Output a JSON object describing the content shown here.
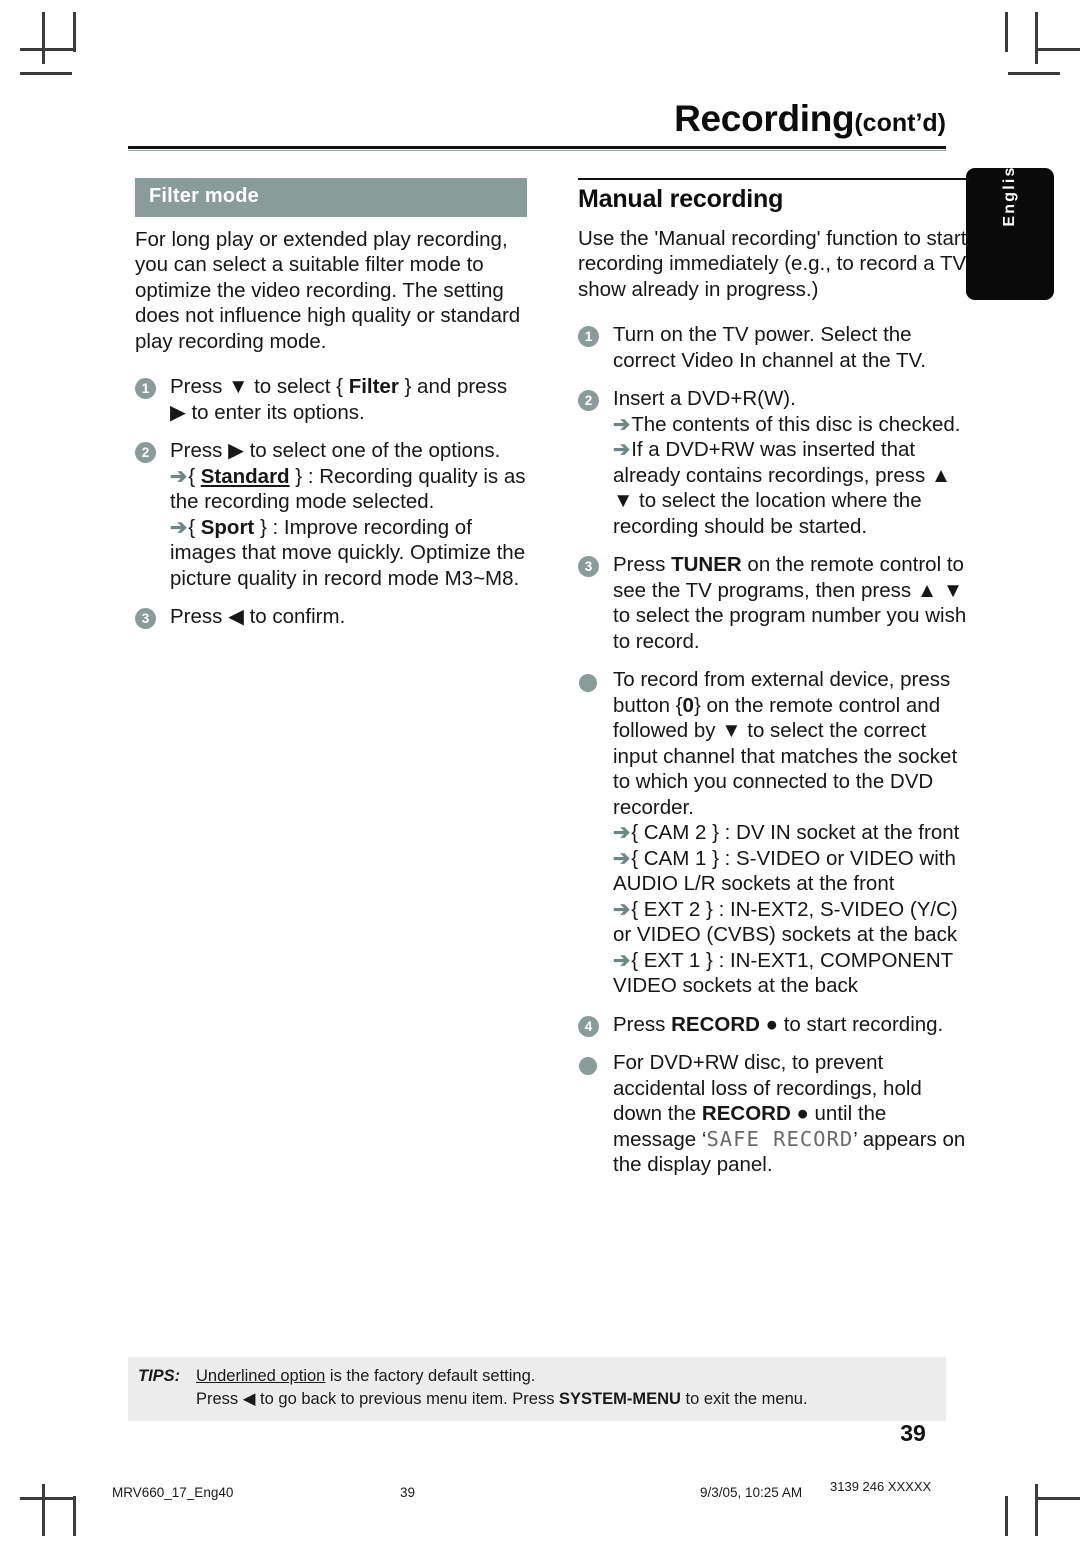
{
  "header": {
    "title": "Recording",
    "title_suffix": "(cont’d)"
  },
  "lang_tab": {
    "label": "English"
  },
  "left_column": {
    "heading": "Filter mode",
    "intro": "For long play or extended play recording, you can select a suitable filter mode to optimize the video recording. The setting does not influence high quality or standard play recording mode.",
    "steps": [
      {
        "num": "1",
        "parts": [
          {
            "t": "Press "
          },
          {
            "t": "▼",
            "style": "plain"
          },
          {
            "t": " to select { "
          },
          {
            "t": "Filter",
            "style": "bold"
          },
          {
            "t": " } and press "
          },
          {
            "t": "▶",
            "style": "plain"
          },
          {
            "t": " to enter its options."
          }
        ]
      },
      {
        "num": "2",
        "parts": [
          {
            "t": "Press "
          },
          {
            "t": "▶",
            "style": "plain"
          },
          {
            "t": " to select one of the options."
          }
        ],
        "arrows": [
          {
            "parts": [
              {
                "t": "{ "
              },
              {
                "t": "Standard",
                "style": "bold-underline"
              },
              {
                "t": " } :  Recording quality is as the recording mode selected."
              }
            ]
          },
          {
            "parts": [
              {
                "t": "{ "
              },
              {
                "t": "Sport",
                "style": "bold"
              },
              {
                "t": " } :  Improve recording of images that move quickly.  Optimize the picture quality in record mode M3~M8."
              }
            ]
          }
        ]
      },
      {
        "num": "3",
        "parts": [
          {
            "t": "Press "
          },
          {
            "t": "◀",
            "style": "plain"
          },
          {
            "t": "  to confirm."
          }
        ]
      }
    ]
  },
  "right_column": {
    "heading": "Manual recording",
    "intro": "Use the 'Manual recording' function to start recording immediately (e.g., to record a TV show already in progress.)",
    "steps": [
      {
        "num": "1",
        "parts": [
          {
            "t": "Turn on the TV power.  Select the correct Video In channel at the TV."
          }
        ]
      },
      {
        "num": "2",
        "parts": [
          {
            "t": "Insert a DVD+R(W)."
          }
        ],
        "arrows": [
          {
            "parts": [
              {
                "t": "The contents of this disc is checked."
              }
            ]
          },
          {
            "parts": [
              {
                "t": "If a DVD+RW was inserted that already contains recordings, press "
              },
              {
                "t": "▲ ▼",
                "style": "plain"
              },
              {
                "t": " to select the location where the recording should be started."
              }
            ]
          }
        ]
      },
      {
        "num": "3",
        "parts": [
          {
            "t": "Press "
          },
          {
            "t": "TUNER",
            "style": "bold"
          },
          {
            "t": " on the remote control to see the TV programs, then press "
          },
          {
            "t": "▲ ▼",
            "style": "plain"
          },
          {
            "t": "  to select the program number you wish to record."
          }
        ]
      }
    ],
    "bullet_external": {
      "parts": [
        {
          "t": "To record from external device, press button {"
        },
        {
          "t": "0",
          "style": "bold"
        },
        {
          "t": "} on the remote control and followed by "
        },
        {
          "t": "▼",
          "style": "plain"
        },
        {
          "t": " to select the correct input channel that matches the socket to which you connected to the DVD recorder."
        }
      ],
      "sockets": [
        {
          "parts": [
            {
              "t": "{ CAM 2 } :  DV IN socket at the front"
            }
          ]
        },
        {
          "parts": [
            {
              "t": "{ CAM 1 } : S-VIDEO or VIDEO with AUDIO L/R sockets at the front"
            }
          ]
        },
        {
          "parts": [
            {
              "t": "{ EXT 2 } :  IN-EXT2, S-VIDEO (Y/C) or VIDEO (CVBS) sockets at the back"
            }
          ]
        },
        {
          "parts": [
            {
              "t": "{ EXT 1 } :  IN-EXT1, COMPONENT VIDEO sockets at the back"
            }
          ]
        }
      ]
    },
    "step4": {
      "num": "4",
      "parts": [
        {
          "t": "Press "
        },
        {
          "t": "RECORD",
          "style": "bold"
        },
        {
          "t": " ●",
          "style": "plain"
        },
        {
          "t": " to start recording."
        }
      ]
    },
    "bullet_safe": {
      "parts": [
        {
          "t": "For DVD+RW disc, to prevent accidental loss of recordings, hold down the "
        },
        {
          "t": "RECORD",
          "style": "bold"
        },
        {
          "t": " ●",
          "style": "plain"
        },
        {
          "t": " until the message ‘"
        },
        {
          "t": "SAFE RECORD",
          "style": "lcd"
        },
        {
          "t": "’ appears on the display panel."
        }
      ]
    }
  },
  "tips": {
    "label": "TIPS:",
    "line1_underlined": "Underlined option",
    "line1_rest": " is the factory default setting.",
    "line2_pre": "Press ",
    "line2_arrow": "◀",
    "line2_mid": " to go back to previous menu item.  Press ",
    "line2_bold": "SYSTEM-MENU",
    "line2_post": " to exit the menu."
  },
  "page_number": "39",
  "print_footer": {
    "file": "MRV660_17_Eng40",
    "page": "39",
    "date": "9/3/05, 10:25 AM",
    "code": "3139 246 XXXXX"
  },
  "colors": {
    "accent": "#8a9c9a",
    "band_heading_bg": "#8a9c9a",
    "tips_bg": "#ececec",
    "tab_bg": "#0a0a0a",
    "rule": "#121212"
  }
}
